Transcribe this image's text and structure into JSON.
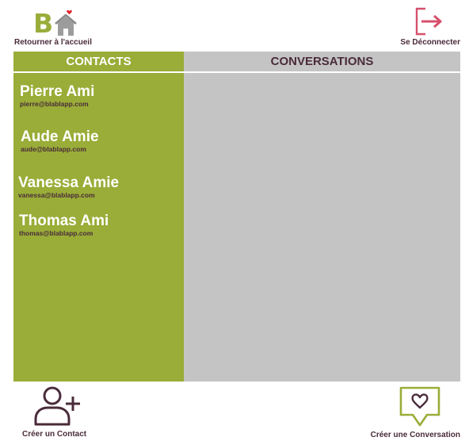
{
  "header": {
    "home_label": "Retourner à l'accueil",
    "logo_letter": "B",
    "logout_label": "Se Déconnecter"
  },
  "contacts": {
    "title": "CONTACTS",
    "items": [
      {
        "name": "Pierre Ami",
        "email": "pierre@blablapp.com"
      },
      {
        "name": "Aude Amie",
        "email": "aude@blablapp.com"
      },
      {
        "name": "Vanessa Amie",
        "email": "vanessa@blablapp.com"
      },
      {
        "name": "Thomas Ami",
        "email": "thomas@blablapp.com"
      }
    ]
  },
  "conversations": {
    "title": "CONVERSATIONS"
  },
  "footer": {
    "create_contact_label": "Créer un Contact",
    "create_conversation_label": "Créer une Conversation"
  },
  "colors": {
    "accent_green": "#99ad38",
    "panel_gray": "#c4c4c4",
    "text_dark": "#4a2b3a",
    "logout_red": "#d6506b",
    "heart_red": "#e0202a"
  },
  "icons": {
    "home": "house-heart-logo-icon",
    "logout": "logout-arrow-icon",
    "add_contact": "add-user-icon",
    "new_conversation": "chat-heart-icon"
  }
}
